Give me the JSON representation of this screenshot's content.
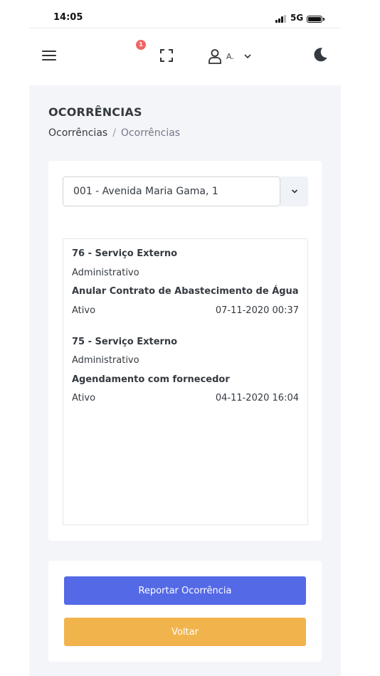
{
  "status_bar": {
    "time": "14:05",
    "network": "5G"
  },
  "topbar": {
    "notification_count": "1",
    "user_name": "A."
  },
  "page": {
    "title": "OCORRÊNCIAS",
    "breadcrumb": [
      "Ocorrências",
      "/",
      "Ocorrências"
    ]
  },
  "address_select": {
    "value": "001 - Avenida Maria Gama, 1"
  },
  "occurrences": [
    {
      "heading": "76 - Serviço Externo",
      "category": "Administrativo",
      "subject": "Anular Contrato de Abastecimento de Água",
      "status": "Ativo",
      "datetime": "07-11-2020 00:37"
    },
    {
      "heading": "75 - Serviço Externo",
      "category": "Administrativo",
      "subject": "Agendamento com fornecedor",
      "status": "Ativo",
      "datetime": "04-11-2020 16:04"
    }
  ],
  "actions": {
    "report_label": "Reportar Ocorrência",
    "back_label": "Voltar"
  },
  "colors": {
    "primary": "#5469e6",
    "warning": "#f1b44c",
    "badge": "#f06565",
    "page_bg": "#f4f5f8"
  },
  "icons": [
    "menu-icon",
    "fullscreen-icon",
    "user-icon",
    "chevron-down-icon",
    "moon-icon"
  ]
}
